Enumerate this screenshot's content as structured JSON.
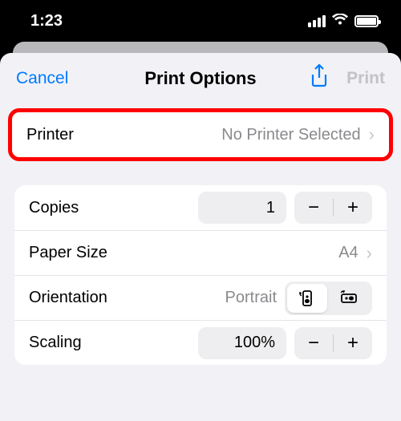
{
  "status": {
    "time": "1:23"
  },
  "nav": {
    "cancel": "Cancel",
    "title": "Print Options",
    "print": "Print"
  },
  "printer": {
    "label": "Printer",
    "value": "No Printer Selected"
  },
  "copies": {
    "label": "Copies",
    "value": "1"
  },
  "paper": {
    "label": "Paper Size",
    "value": "A4"
  },
  "orientation": {
    "label": "Orientation",
    "value": "Portrait"
  },
  "scaling": {
    "label": "Scaling",
    "value": "100%"
  }
}
